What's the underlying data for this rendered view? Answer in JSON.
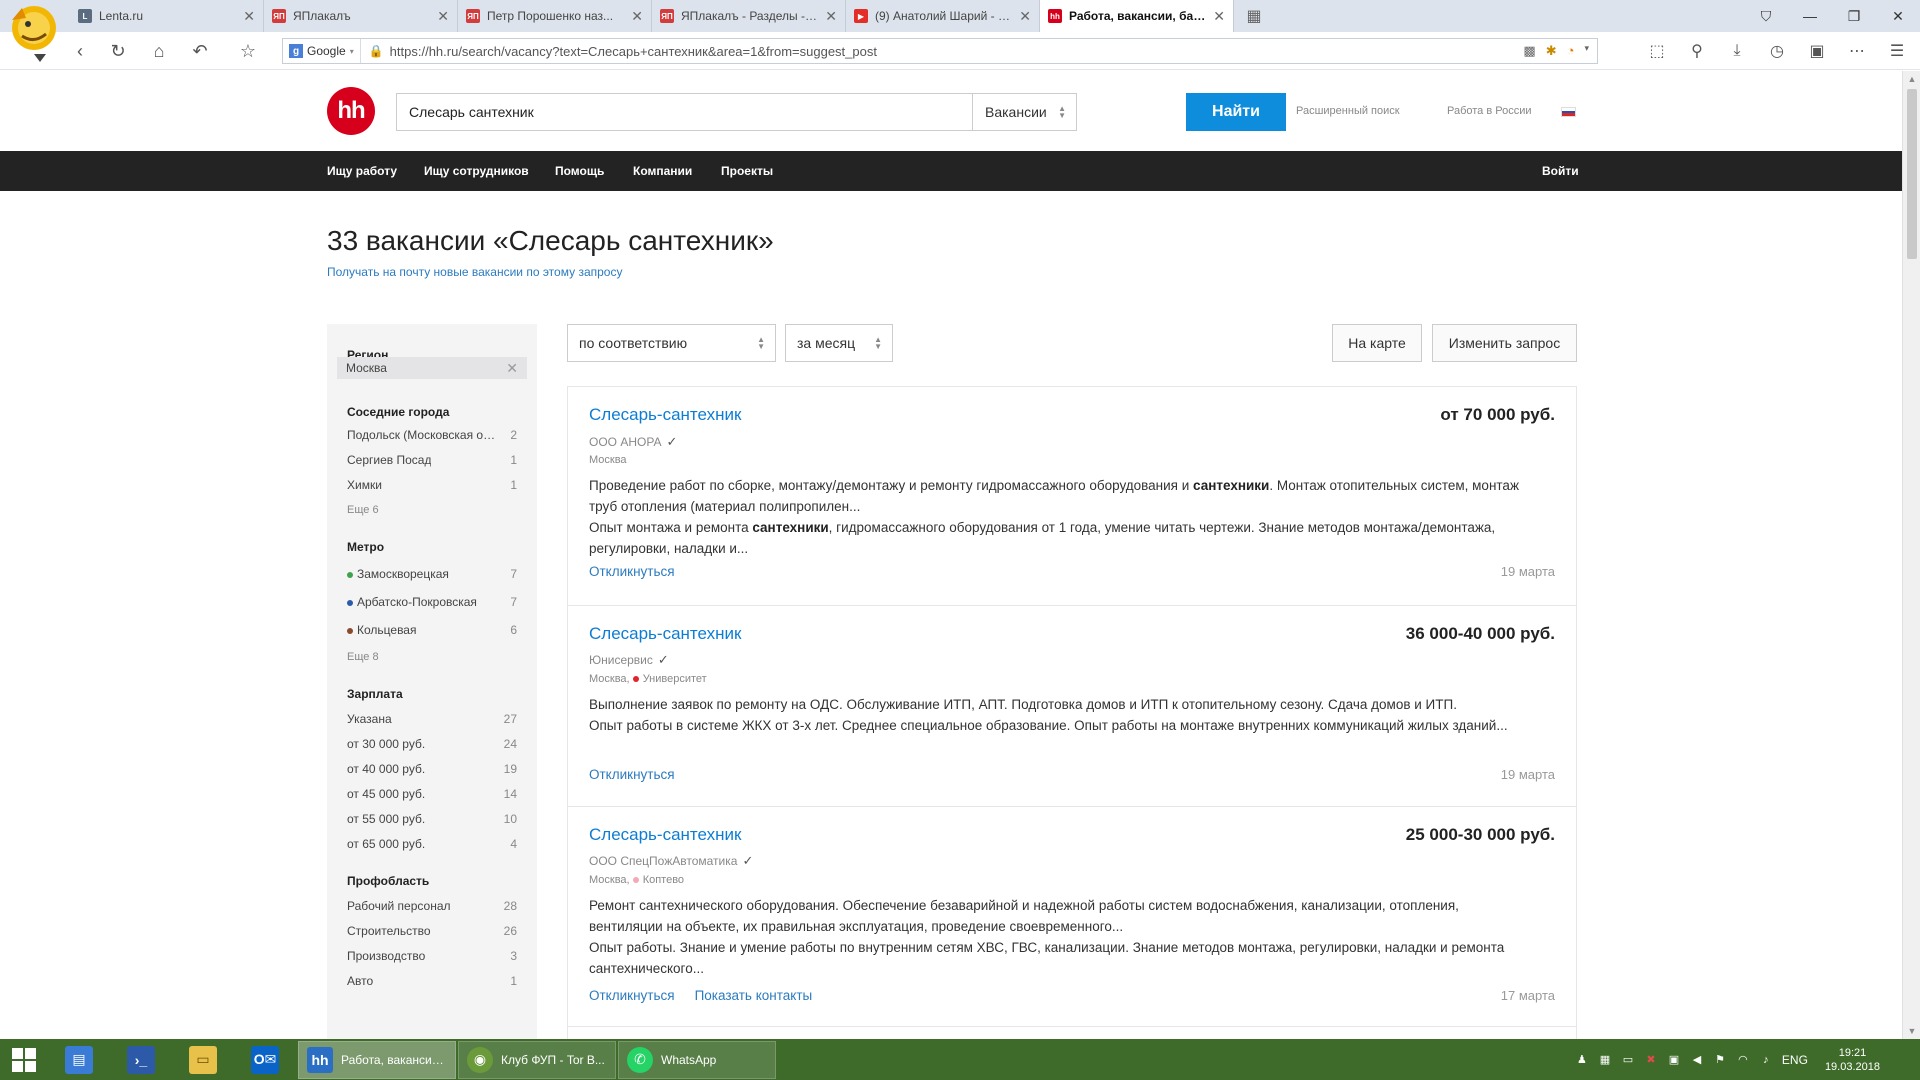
{
  "browser": {
    "tabs": [
      {
        "title": "Lenta.ru",
        "icon": "L",
        "color": "#5b6b80",
        "active": false
      },
      {
        "title": "ЯПлакалъ",
        "icon": "ЯП",
        "color": "#d23c3c",
        "active": false
      },
      {
        "title": "Петр Порошенко наз...",
        "icon": "ЯП",
        "color": "#d23c3c",
        "active": false
      },
      {
        "title": "ЯПлакалъ - Разделы -> ...",
        "icon": "ЯП",
        "color": "#d23c3c",
        "active": false
      },
      {
        "title": "(9) Анатолий Шарий - Y...",
        "icon": "▶",
        "color": "#e52d27",
        "active": false
      },
      {
        "title": "Работа, вакансии, база...",
        "icon": "hh",
        "color": "#d6001c",
        "active": true
      }
    ],
    "search_engine": "Google",
    "url": "https://hh.ru/search/vacancy?text=Слесарь+сантехник&area=1&from=suggest_post"
  },
  "header": {
    "logo": "hh",
    "search_value": "Слесарь сантехник",
    "search_type": "Вакансии",
    "find_label": "Найти",
    "advanced_search": "Расширенный поиск",
    "work_russia": "Работа в России"
  },
  "menu": {
    "items": [
      "Ищу работу",
      "Ищу сотрудников",
      "Помощь",
      "Компании",
      "Проекты"
    ],
    "login": "Войти"
  },
  "results": {
    "title": "33 вакансии «Слесарь сантехник»",
    "subscribe": "Получать на почту новые вакансии по этому запросу"
  },
  "filters": {
    "region_head": "Регион",
    "region_value": "Москва",
    "neighbors_head": "Соседние города",
    "neighbors": [
      {
        "label": "Подольск (Московская об...",
        "count": "2"
      },
      {
        "label": "Сергиев Посад",
        "count": "1"
      },
      {
        "label": "Химки",
        "count": "1"
      }
    ],
    "neighbors_more": "Еще 6",
    "metro_head": "Метро",
    "metro": [
      {
        "label": "Замоскворецкая",
        "count": "7",
        "color": "#3fa34d"
      },
      {
        "label": "Арбатско-Покровская",
        "count": "7",
        "color": "#2a5caa"
      },
      {
        "label": "Кольцевая",
        "count": "6",
        "color": "#8b4a2b"
      }
    ],
    "metro_more": "Еще 8",
    "salary_head": "Зарплата",
    "salary": [
      {
        "label": "Указана",
        "count": "27"
      },
      {
        "label": "от 30 000 руб.",
        "count": "24"
      },
      {
        "label": "от 40 000 руб.",
        "count": "19"
      },
      {
        "label": "от 45 000 руб.",
        "count": "14"
      },
      {
        "label": "от 55 000 руб.",
        "count": "10"
      },
      {
        "label": "от 65 000 руб.",
        "count": "4"
      }
    ],
    "prof_head": "Профобласть",
    "prof": [
      {
        "label": "Рабочий персонал",
        "count": "28"
      },
      {
        "label": "Строительство",
        "count": "26"
      },
      {
        "label": "Производство",
        "count": "3"
      },
      {
        "label": "Авто",
        "count": "1"
      }
    ]
  },
  "controls": {
    "sort": "по соответствию",
    "period": "за месяц",
    "map": "На карте",
    "change": "Изменить запрос"
  },
  "vacancies": [
    {
      "title": "Слесарь-сантехник",
      "salary": "от 70 000 руб.",
      "company": "ООО АНОРА",
      "location": "Москва",
      "metro": "",
      "desc1_a": "Проведение работ по сборке, монтажу/демонтажу и ремонту гидромассажного оборудования и ",
      "desc1_hl": "сантехники",
      "desc1_b": ". Монтаж отопительных систем, монтаж труб отопления (материал полипропилен...",
      "desc2_a": "Опыт монтажа и ремонта ",
      "desc2_hl": "сантехники",
      "desc2_b": ", гидромассажного оборудования от 1 года, умение читать чертежи. Знание методов монтажа/демонтажа, регулировки, наладки и...",
      "respond": "Откликнуться",
      "contacts": "",
      "date": "19 марта"
    },
    {
      "title": "Слесарь-сантехник",
      "salary": "36 000-40 000 руб.",
      "company": "Юнисервис",
      "location": "Москва,",
      "metro": "Университет",
      "metro_color": "#e4232b",
      "desc1_a": "Выполнение заявок по ремонту на ОДС. Обслуживание ИТП, АПТ. Подготовка домов и ИТП к отопительному сезону. Сдача домов и ИТП.",
      "desc1_hl": "",
      "desc1_b": "",
      "desc2_a": "Опыт работы в системе ЖКХ от 3-х лет. Среднее специальное образование. Опыт работы на монтаже внутренних коммуникаций жилых зданий...",
      "desc2_hl": "",
      "desc2_b": "",
      "respond": "Откликнуться",
      "contacts": "",
      "date": "19 марта"
    },
    {
      "title": "Слесарь-сантехник",
      "salary": "25 000-30 000 руб.",
      "company": "ООО СпецПожАвтоматика",
      "location": "Москва,",
      "metro": "Коптево",
      "metro_color": "#f4a8b8",
      "desc1_a": "Ремонт сантехнического оборудования. Обеспечение безаварийной и надежной работы систем водоснабжения, канализации, отопления, вентиляции на объекте, их правильная эксплуатация, проведение своевременного...",
      "desc1_hl": "",
      "desc1_b": "",
      "desc2_a": "Опыт работы. Знание и умение работы по внутренним сетям ХВС, ГВС, канализации. Знание методов монтажа, регулировки, наладки и ремонта сантехнического...",
      "desc2_hl": "",
      "desc2_b": "",
      "respond": "Откликнуться",
      "contacts": "Показать контакты",
      "date": "17 марта"
    }
  ],
  "taskbar": {
    "windows": [
      {
        "title": "Работа, вакансии...",
        "icon": "hh",
        "color": "#2a6fc4",
        "active": true
      },
      {
        "title": "Клуб ФУП - Tor B...",
        "icon": "◉",
        "color": "#6a9a3a",
        "active": false
      },
      {
        "title": "WhatsApp",
        "icon": "✆",
        "color": "#25d366",
        "active": false
      }
    ],
    "lang": "ENG",
    "time": "19:21",
    "date": "19.03.2018"
  }
}
